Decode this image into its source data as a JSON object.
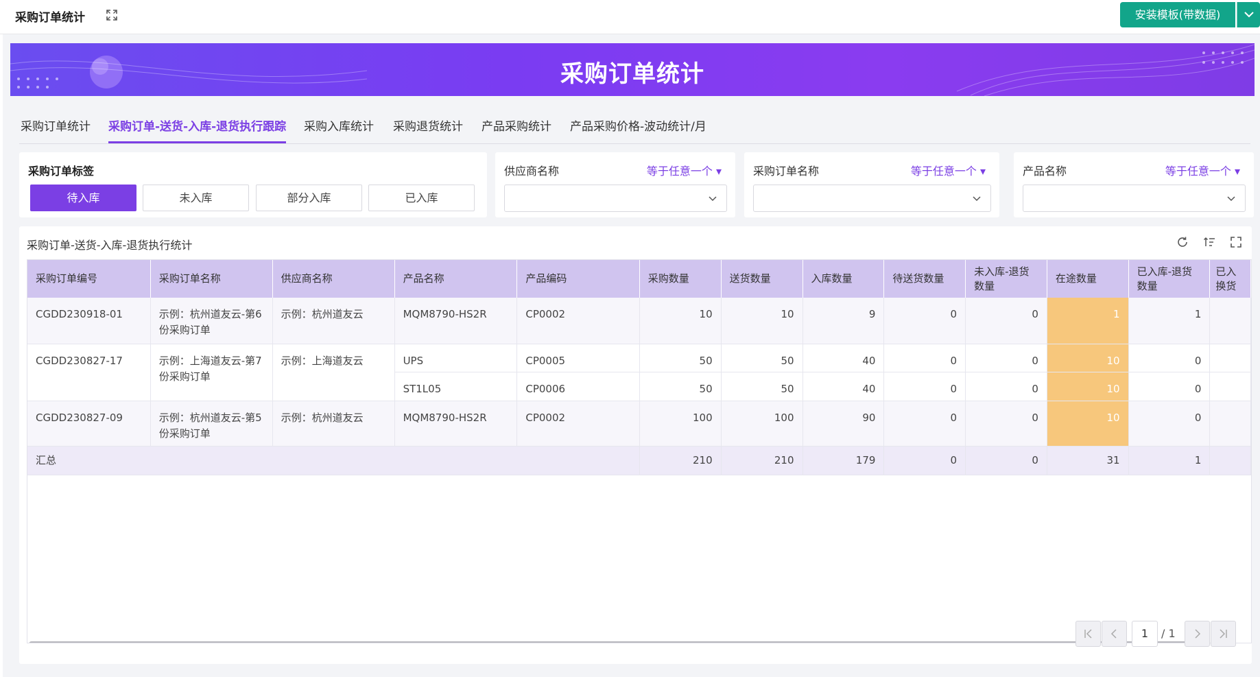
{
  "header": {
    "title": "采购订单统计",
    "install_label": "安装模板(带数据)"
  },
  "banner": {
    "title": "采购订单统计"
  },
  "tabs": [
    {
      "label": "采购订单统计",
      "active": false
    },
    {
      "label": "采购订单-送货-入库-退货执行跟踪",
      "active": true
    },
    {
      "label": "采购入库统计",
      "active": false
    },
    {
      "label": "采购退货统计",
      "active": false
    },
    {
      "label": "产品采购统计",
      "active": false
    },
    {
      "label": "产品采购价格-波动统计/月",
      "active": false
    }
  ],
  "filters": {
    "tag": {
      "label": "采购订单标签",
      "options": [
        "待入库",
        "未入库",
        "部分入库",
        "已入库"
      ],
      "selected": "待入库"
    },
    "supplier": {
      "label": "供应商名称",
      "operator": "等于任意一个",
      "value": ""
    },
    "order_name": {
      "label": "采购订单名称",
      "operator": "等于任意一个",
      "value": ""
    },
    "product": {
      "label": "产品名称",
      "operator": "等于任意一个",
      "value": ""
    }
  },
  "table": {
    "title": "采购订单-送货-入库-退货执行统计",
    "columns": [
      "采购订单编号",
      "采购订单名称",
      "供应商名称",
      "产品名称",
      "产品编码",
      "采购数量",
      "送货数量",
      "入库数量",
      "待送货数量",
      "未入库-退货数量",
      "在途数量",
      "已入库-退货数量",
      "已入库换货"
    ],
    "visible_last_column_text": "已入换货",
    "groups": [
      {
        "order_no": "CGDD230918-01",
        "order_name": "示例：杭州道友云-第6份采购订单",
        "supplier": "示例：杭州道友云",
        "items": [
          {
            "product": "MQM8790-HS2R",
            "code": "CP0002",
            "qty": "10",
            "sent": "10",
            "stored": "9",
            "pending": "0",
            "unstored_return": "0",
            "in_transit": "1",
            "stored_return": "1"
          }
        ]
      },
      {
        "order_no": "CGDD230827-17",
        "order_name": "示例：上海道友云-第7份采购订单",
        "supplier": "示例：上海道友云",
        "items": [
          {
            "product": "UPS",
            "code": "CP0005",
            "qty": "50",
            "sent": "50",
            "stored": "40",
            "pending": "0",
            "unstored_return": "0",
            "in_transit": "10",
            "stored_return": "0"
          },
          {
            "product": "ST1L05",
            "code": "CP0006",
            "qty": "50",
            "sent": "50",
            "stored": "40",
            "pending": "0",
            "unstored_return": "0",
            "in_transit": "10",
            "stored_return": "0"
          }
        ]
      },
      {
        "order_no": "CGDD230827-09",
        "order_name": "示例：杭州道友云-第5份采购订单",
        "supplier": "示例：杭州道友云",
        "items": [
          {
            "product": "MQM8790-HS2R",
            "code": "CP0002",
            "qty": "100",
            "sent": "100",
            "stored": "90",
            "pending": "0",
            "unstored_return": "0",
            "in_transit": "10",
            "stored_return": "0"
          }
        ]
      }
    ],
    "summary": {
      "label": "汇总",
      "qty": "210",
      "sent": "210",
      "stored": "179",
      "pending": "0",
      "unstored_return": "0",
      "in_transit": "31",
      "stored_return": "1"
    }
  },
  "pager": {
    "current": "1",
    "total": "/ 1"
  },
  "colors": {
    "accent": "#7b3fe4",
    "install": "#12a58a",
    "highlight": "#f7c77c",
    "header_bg": "#d0c4ef"
  }
}
